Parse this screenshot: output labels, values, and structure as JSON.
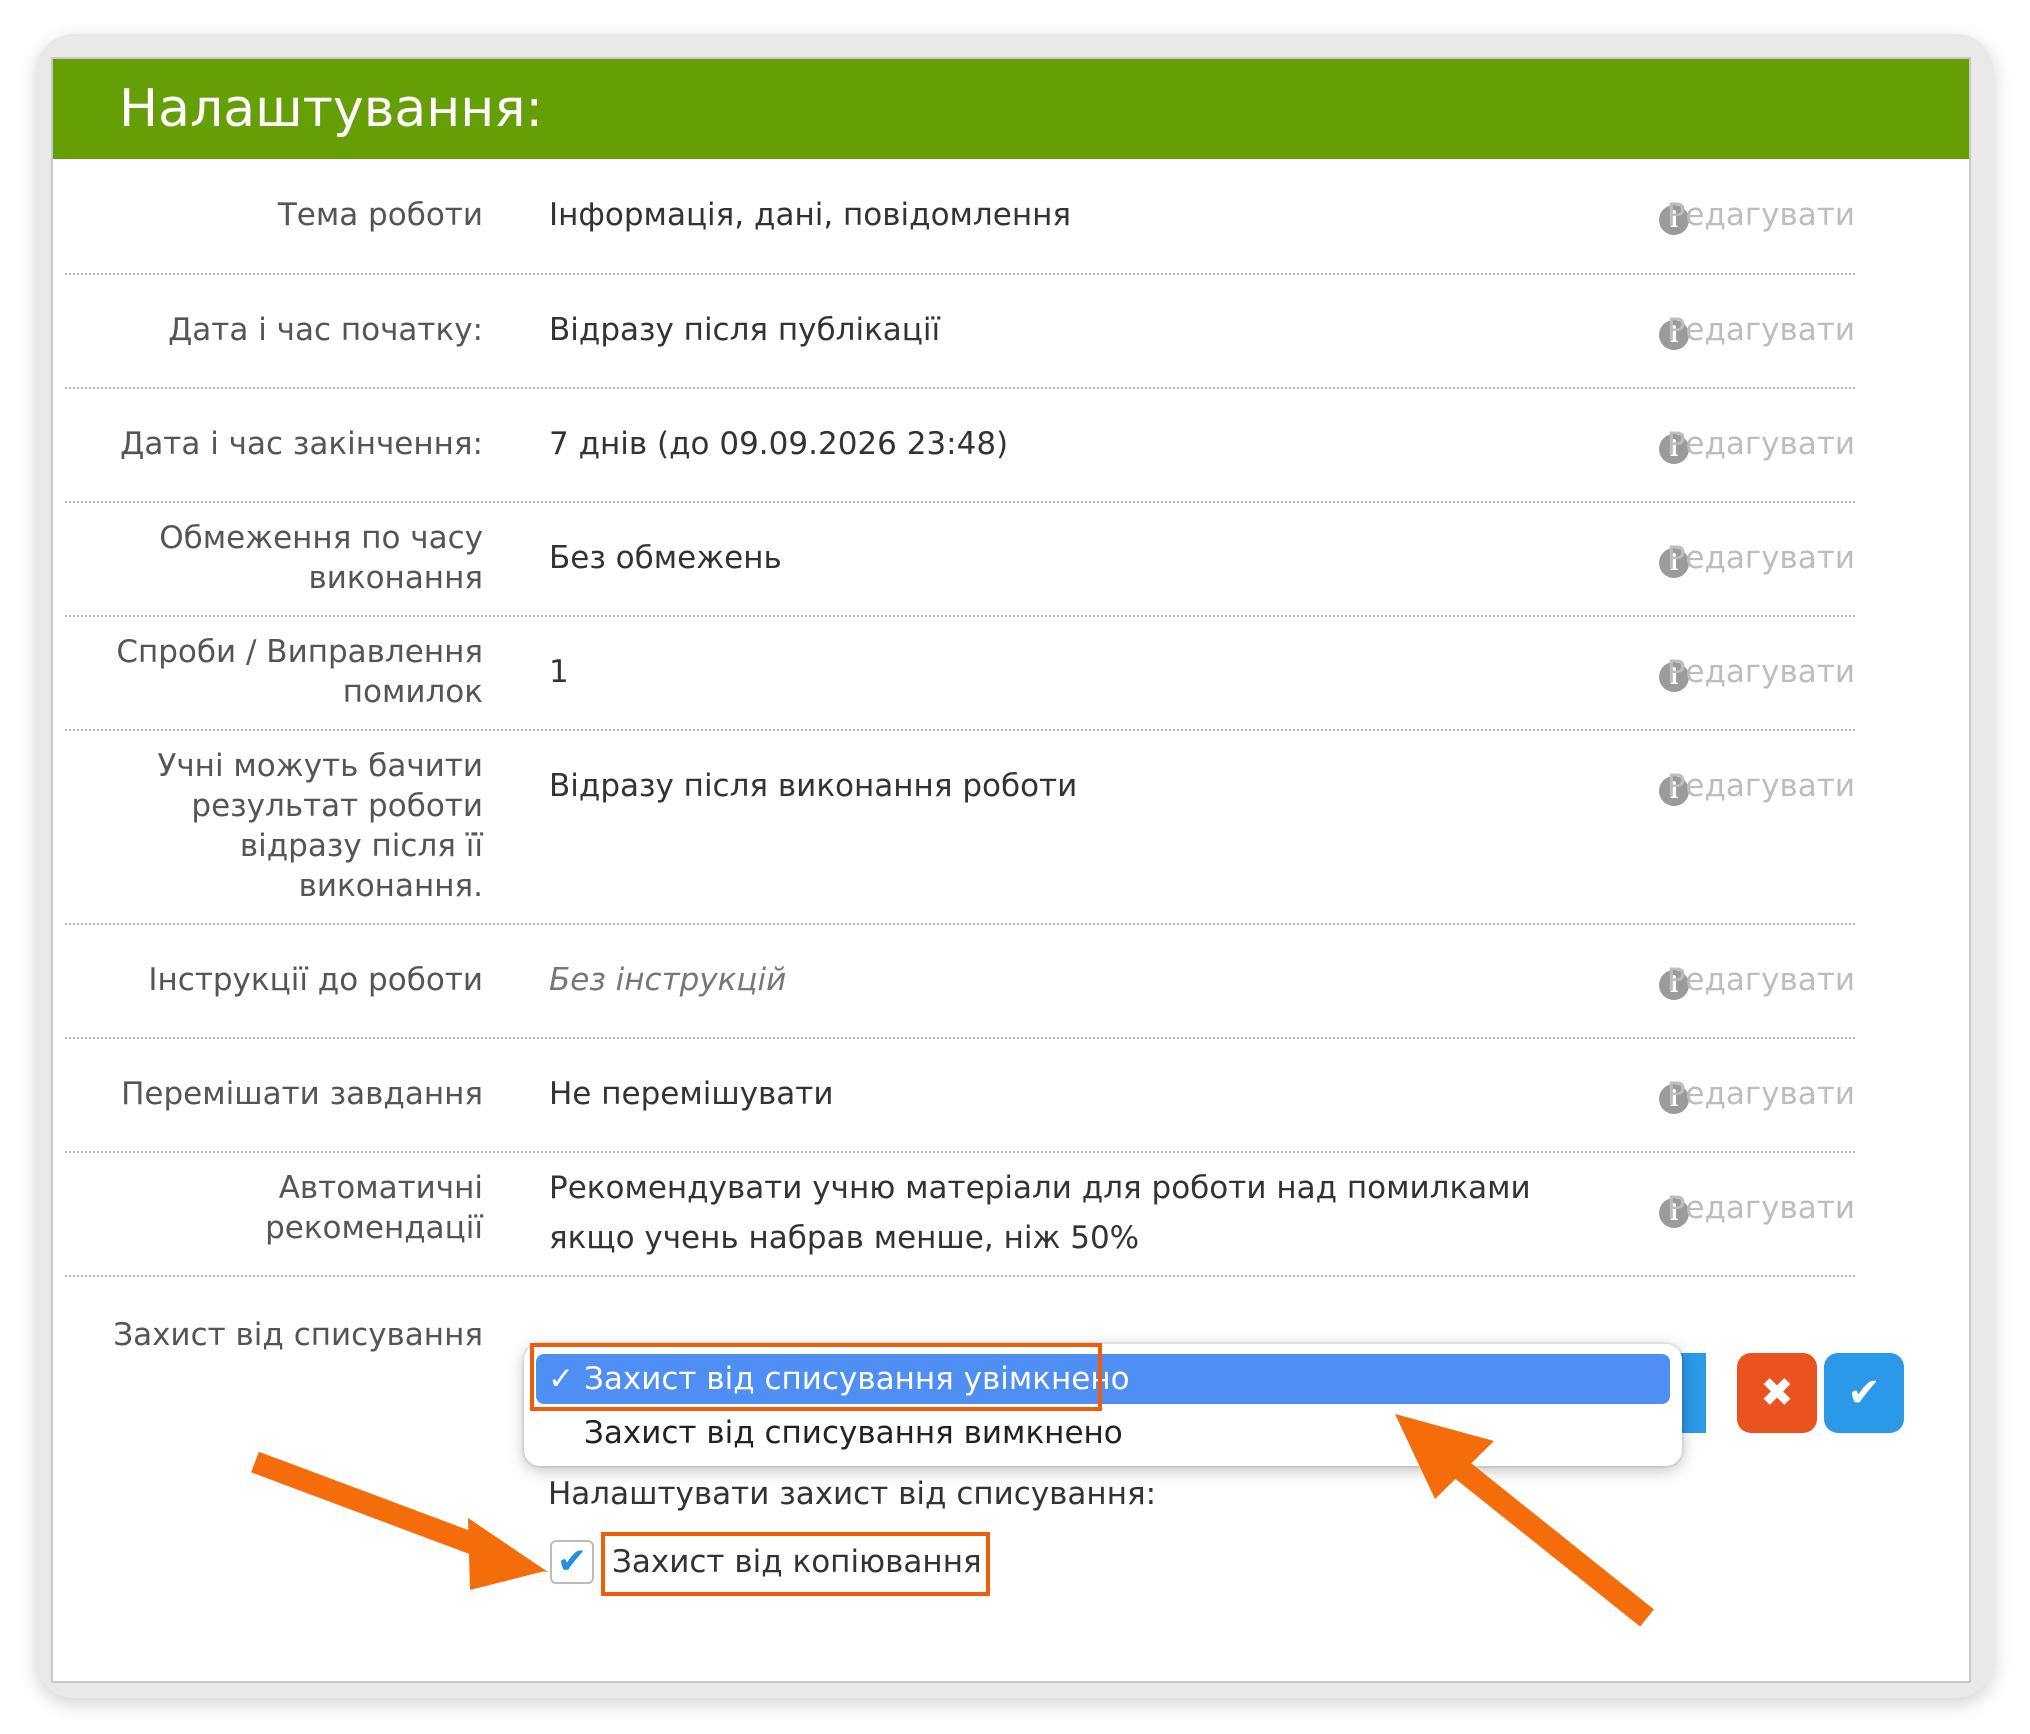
{
  "header": {
    "title": "Налаштування:"
  },
  "rows": [
    {
      "label": "Тема роботи",
      "value": "Інформація, дані, повідомлення",
      "edit": "Редагувати"
    },
    {
      "label": "Дата і час початку:",
      "value": "Відразу після публікації",
      "edit": "Редагувати"
    },
    {
      "label": "Дата і час закінчення:",
      "value": "7 днів (до 09.09.2026 23:48)",
      "edit": "Редагувати"
    },
    {
      "label_lines": [
        "Обмеження по часу",
        "виконання"
      ],
      "value": "Без обмежень",
      "edit": "Редагувати"
    },
    {
      "label_lines": [
        "Спроби / Виправлення",
        "помилок"
      ],
      "value": "1",
      "edit": "Редагувати"
    },
    {
      "label_lines": [
        "Учні можуть бачити",
        "результат роботи",
        "відразу після її",
        "виконання."
      ],
      "value": "Відразу після виконання роботи",
      "edit": "Редагувати"
    },
    {
      "label": "Інструкції до роботи",
      "value": "Без інструкцій",
      "edit": "Редагувати"
    },
    {
      "label": "Перемішати завдання",
      "value": "Не перемішувати",
      "edit": "Редагувати"
    },
    {
      "label_lines": [
        "Автоматичні",
        "рекомендації"
      ],
      "value_lines": [
        "Рекомендувати учню матеріали для роботи над помилками",
        "якщо учень набрав менше, ніж 50%"
      ],
      "edit": "Редагувати"
    }
  ],
  "info_icon_glyph": "i",
  "antiplagiarism": {
    "label": "Захист від списування",
    "options": [
      {
        "label": "Захист від списування увімкнено",
        "selected": true,
        "check": "✓"
      },
      {
        "label": "Захист від списування вимкнено",
        "selected": false
      }
    ],
    "cancel_glyph": "✖",
    "ok_glyph": "✔",
    "subtitle": "Налаштувати захист від списування:",
    "copy_protection": {
      "label": "Захист від копіювання",
      "checked": true,
      "check": "✔"
    }
  },
  "colors": {
    "header": "#659f05",
    "cancel": "#ea5320",
    "ok": "#2c99e8",
    "selected_option": "#4f8ef3",
    "highlight": "#f05d0a"
  }
}
